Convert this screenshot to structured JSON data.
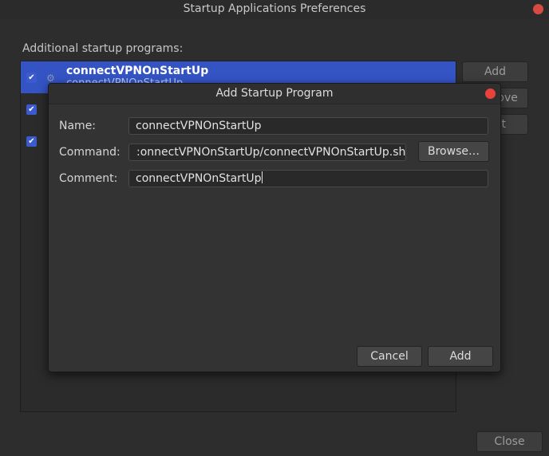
{
  "main_window": {
    "title": "Startup Applications Preferences",
    "section_label": "Additional startup programs:",
    "programs": [
      {
        "name": "connectVPNOnStartUp",
        "comment": "connectVPNOnStartUp",
        "enabled": true,
        "selected": true
      },
      {
        "name": "",
        "comment": "",
        "enabled": true,
        "selected": false
      },
      {
        "name": "",
        "comment": "",
        "enabled": true,
        "selected": false
      }
    ],
    "buttons": {
      "add": "Add",
      "remove": "Remove",
      "edit": "Edit",
      "close": "Close"
    }
  },
  "dialog": {
    "title": "Add Startup Program",
    "name_label": "Name:",
    "name_value": "connectVPNOnStartUp",
    "command_label": "Command:",
    "command_value": ":onnectVPNOnStartUp/connectVPNOnStartUp.sh",
    "browse_label": "Browse…",
    "comment_label": "Comment:",
    "comment_value": "connectVPNOnStartUp",
    "cancel_label": "Cancel",
    "add_label": "Add"
  },
  "colors": {
    "selection": "#3454c4",
    "close_button": "#e8423b",
    "window_bg": "#2d2d2d",
    "dialog_bg": "#333333"
  }
}
